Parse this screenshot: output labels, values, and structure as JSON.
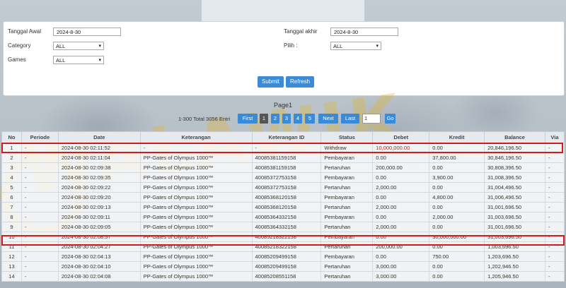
{
  "filter": {
    "tanggal_awal_label": "Tanggal Awal",
    "tanggal_awal_value": "2024-8-30",
    "tanggal_akhir_label": "Tanggal akhir",
    "tanggal_akhir_value": "2024-8-30",
    "category_label": "Category",
    "category_value": "ALL",
    "pilih_label": "Pilih  :",
    "pilih_value": "ALL",
    "games_label": "Games",
    "games_value": "ALL",
    "submit_label": "Submit",
    "refresh_label": "Refresh"
  },
  "pagination": {
    "title": "Page1",
    "total_info": "1-300 Total 3056 Entri",
    "first_label": "First",
    "pages": [
      "1",
      "2",
      "3",
      "4",
      "5"
    ],
    "next_label": "Next",
    "last_label": "Last",
    "page_input_value": "1",
    "go_label": "Go"
  },
  "table": {
    "headers": [
      "No",
      "Periode",
      "Date",
      "Keterangan",
      "Keterangan ID",
      "Status",
      "Debet",
      "Kredit",
      "Balance",
      "Via"
    ],
    "rows": [
      [
        "1",
        "-",
        "2024-08-30 02:11:52",
        "-",
        "-",
        "Withdraw",
        "10,000,000.00",
        "0.00",
        "20,846,196.50",
        "-"
      ],
      [
        "2",
        "-",
        "2024-08-30 02:11:04",
        "PP-Gates of Olympus 1000™",
        "40085381159158",
        "Pembayaran",
        "0.00",
        "37,800.00",
        "30,846,196.50",
        "-"
      ],
      [
        "3",
        "-",
        "2024-08-30 02:09:38",
        "PP-Gates of Olympus 1000™",
        "40085381159158",
        "Pertaruhan",
        "200,000.00",
        "0.00",
        "30,808,396.50",
        "-"
      ],
      [
        "4",
        "-",
        "2024-08-30 02:09:35",
        "PP-Gates of Olympus 1000™",
        "40085372753158",
        "Pembayaran",
        "0.00",
        "3,900.00",
        "31,008,396.50",
        "-"
      ],
      [
        "5",
        "-",
        "2024-08-30 02:09:22",
        "PP-Gates of Olympus 1000™",
        "40085372753158",
        "Pertaruhan",
        "2,000.00",
        "0.00",
        "31,004,496.50",
        "-"
      ],
      [
        "6",
        "-",
        "2024-08-30 02:09:20",
        "PP-Gates of Olympus 1000™",
        "40085368120158",
        "Pembayaran",
        "0.00",
        "4,800.00",
        "31,006,496.50",
        "-"
      ],
      [
        "7",
        "-",
        "2024-08-30 02:09:13",
        "PP-Gates of Olympus 1000™",
        "40085368120158",
        "Pertaruhan",
        "2,000.00",
        "0.00",
        "31,001,696.50",
        "-"
      ],
      [
        "8",
        "-",
        "2024-08-30 02:09:11",
        "PP-Gates of Olympus 1000™",
        "40085364332158",
        "Pembayaran",
        "0.00",
        "2,000.00",
        "31,003,696.50",
        "-"
      ],
      [
        "9",
        "-",
        "2024-08-30 02:09:05",
        "PP-Gates of Olympus 1000™",
        "40085364332158",
        "Pertaruhan",
        "2,000.00",
        "0.00",
        "31,001,696.50",
        "-"
      ],
      [
        "10",
        "-",
        "2024-08-30 02:08:57",
        "PP-Gates of Olympus 1000™",
        "40085218322158",
        "Pembayaran",
        "0.00",
        "30,000,000.00",
        "31,003,696.50",
        "-"
      ],
      [
        "11",
        "-",
        "2024-08-30 02:04:27",
        "PP-Gates of Olympus 1000™",
        "40085218322158",
        "Pertaruhan",
        "200,000.00",
        "0.00",
        "1,003,696.50",
        "-"
      ],
      [
        "12",
        "-",
        "2024-08-30 02:04:13",
        "PP-Gates of Olympus 1000™",
        "40085209499158",
        "Pembayaran",
        "0.00",
        "750.00",
        "1,203,696.50",
        "-"
      ],
      [
        "13",
        "-",
        "2024-08-30 02:04:10",
        "PP-Gates of Olympus 1000™",
        "40085209499158",
        "Pertaruhan",
        "3,000.00",
        "0.00",
        "1,202,946.50",
        "-"
      ],
      [
        "14",
        "-",
        "2024-08-30 02:04:08",
        "PP-Gates of Olympus 1000™",
        "40085208551158",
        "Pertaruhan",
        "3,000.00",
        "0.00",
        "1,205,946.50",
        "-"
      ]
    ]
  },
  "watermark": "WALAWIK",
  "colors": {
    "accent": "#3a8ad6",
    "highlight": "#d01c1c",
    "link": "#2e6db4"
  }
}
